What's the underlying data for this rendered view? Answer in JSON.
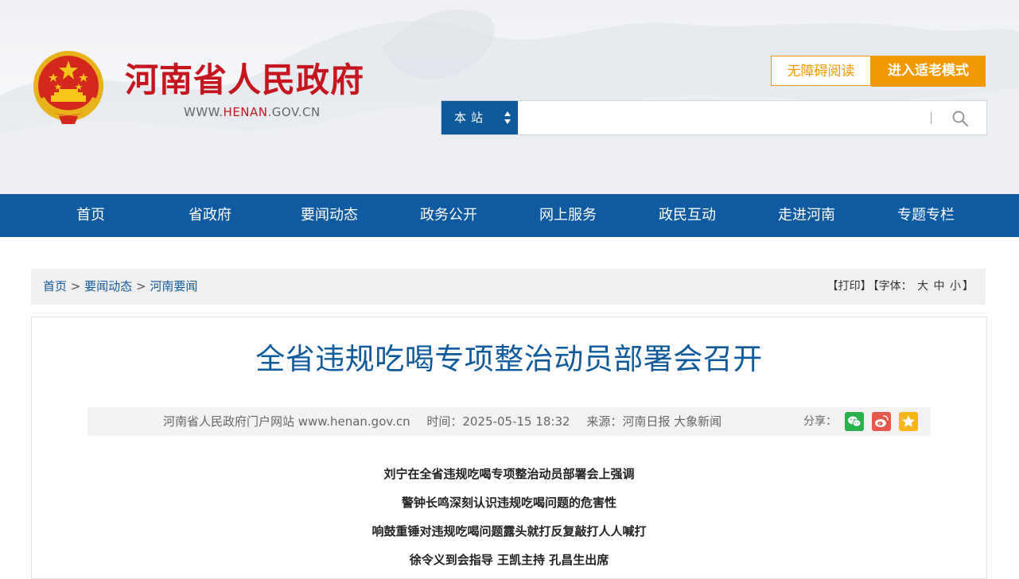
{
  "header": {
    "site_title": "河南省人民政府",
    "site_url_prefix": "WWW.",
    "site_url_domain": "HENAN",
    "site_url_suffix": ".GOV.CN",
    "accessibility_label": "无障碍阅读",
    "elder_mode_label": "进入适老模式",
    "search": {
      "scope_label": "本站",
      "placeholder": "",
      "value": ""
    }
  },
  "nav": {
    "items": [
      {
        "label": "首页"
      },
      {
        "label": "省政府"
      },
      {
        "label": "要闻动态"
      },
      {
        "label": "政务公开"
      },
      {
        "label": "网上服务"
      },
      {
        "label": "政民互动"
      },
      {
        "label": "走进河南"
      },
      {
        "label": "专题专栏"
      }
    ]
  },
  "breadcrumb": {
    "items": [
      "首页",
      "要闻动态",
      "河南要闻"
    ],
    "separator": ">"
  },
  "tools": {
    "print_label": "【打印】",
    "font_label": "【字体：",
    "font_large": "大",
    "font_medium": "中",
    "font_small": "小",
    "font_close": "】"
  },
  "article": {
    "title": "全省违规吃喝专项整治动员部署会召开",
    "meta": {
      "site": "河南省人民政府门户网站 www.henan.gov.cn",
      "time": "时间：2025-05-15 18:32",
      "source": "来源：河南日报 大象新闻",
      "share_label": "分享："
    },
    "subtitles": [
      "刘宁在全省违规吃喝专项整治动员部署会上强调",
      "警钟长鸣深刻认识违规吃喝问题的危害性",
      "响鼓重锤对违规吃喝问题露头就打反复敲打人人喊打",
      "徐令义到会指导 王凯主持 孔昌生出席"
    ]
  },
  "colors": {
    "brand_red": "#c4161c",
    "nav_blue": "#0f5aa0",
    "accent_orange": "#f39800",
    "title_blue": "#0f5a9c"
  }
}
